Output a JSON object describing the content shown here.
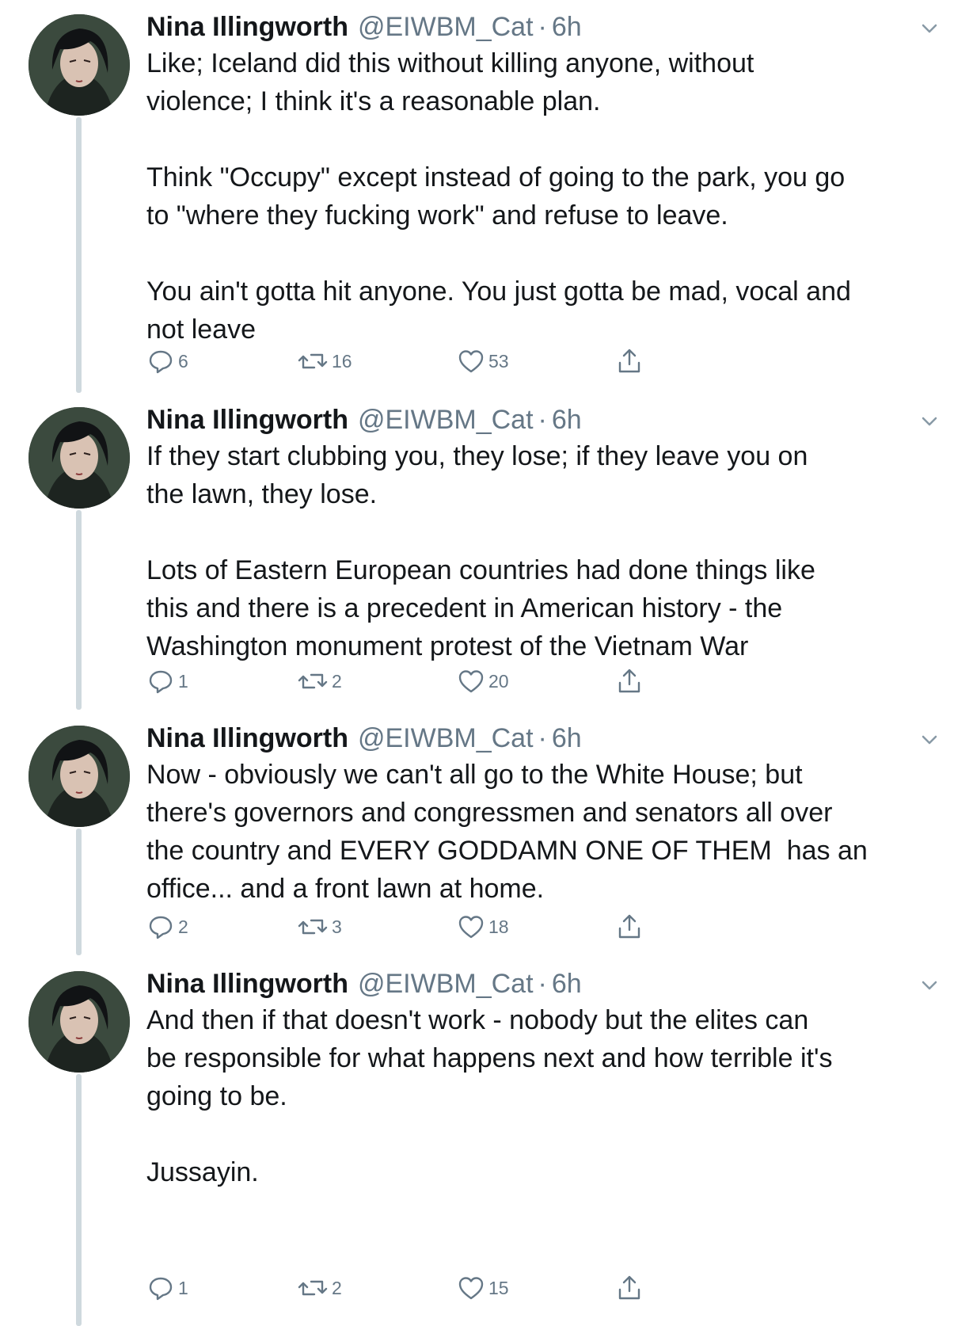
{
  "tweets": [
    {
      "name": "Nina Illingworth",
      "handle": "@EIWBM_Cat",
      "separator": "·",
      "time": "6h",
      "text": "Like; Iceland did this without killing anyone, without\nviolence; I think it's a reasonable plan.\n\nThink \"Occupy\" except instead of going to the park, you go\nto \"where they fucking work\" and refuse to leave.\n\nYou ain't gotta hit anyone. You just gotta be mad, vocal and\nnot leave",
      "replies": "6",
      "retweets": "16",
      "likes": "53"
    },
    {
      "name": "Nina Illingworth",
      "handle": "@EIWBM_Cat",
      "separator": "·",
      "time": "6h",
      "text": "If they start clubbing you, they lose; if they leave you on\nthe lawn, they lose.\n\nLots of Eastern European countries had done things like\nthis and there is a precedent in American history - the\nWashington monument protest of the Vietnam War",
      "replies": "1",
      "retweets": "2",
      "likes": "20"
    },
    {
      "name": "Nina Illingworth",
      "handle": "@EIWBM_Cat",
      "separator": "·",
      "time": "6h",
      "text": "Now - obviously we can't all go to the White House; but\nthere's governors and congressmen and senators all over\nthe country and EVERY GODDAMN ONE OF THEM  has an\noffice... and a front lawn at home.",
      "replies": "2",
      "retweets": "3",
      "likes": "18"
    },
    {
      "name": "Nina Illingworth",
      "handle": "@EIWBM_Cat",
      "separator": "·",
      "time": "6h",
      "text": "And then if that doesn't work - nobody but the elites can\nbe responsible for what happens next and how terrible it's\ngoing to be.\n\nJussayin.",
      "replies": "1",
      "retweets": "2",
      "likes": "15"
    }
  ],
  "icons": {
    "reply": "reply-icon",
    "retweet": "retweet-icon",
    "like": "heart-icon",
    "share": "share-icon",
    "menu": "chevron-down-icon"
  },
  "colors": {
    "text": "#14171a",
    "secondary": "#657786",
    "thread_line": "#cfd9de",
    "background": "#ffffff"
  }
}
